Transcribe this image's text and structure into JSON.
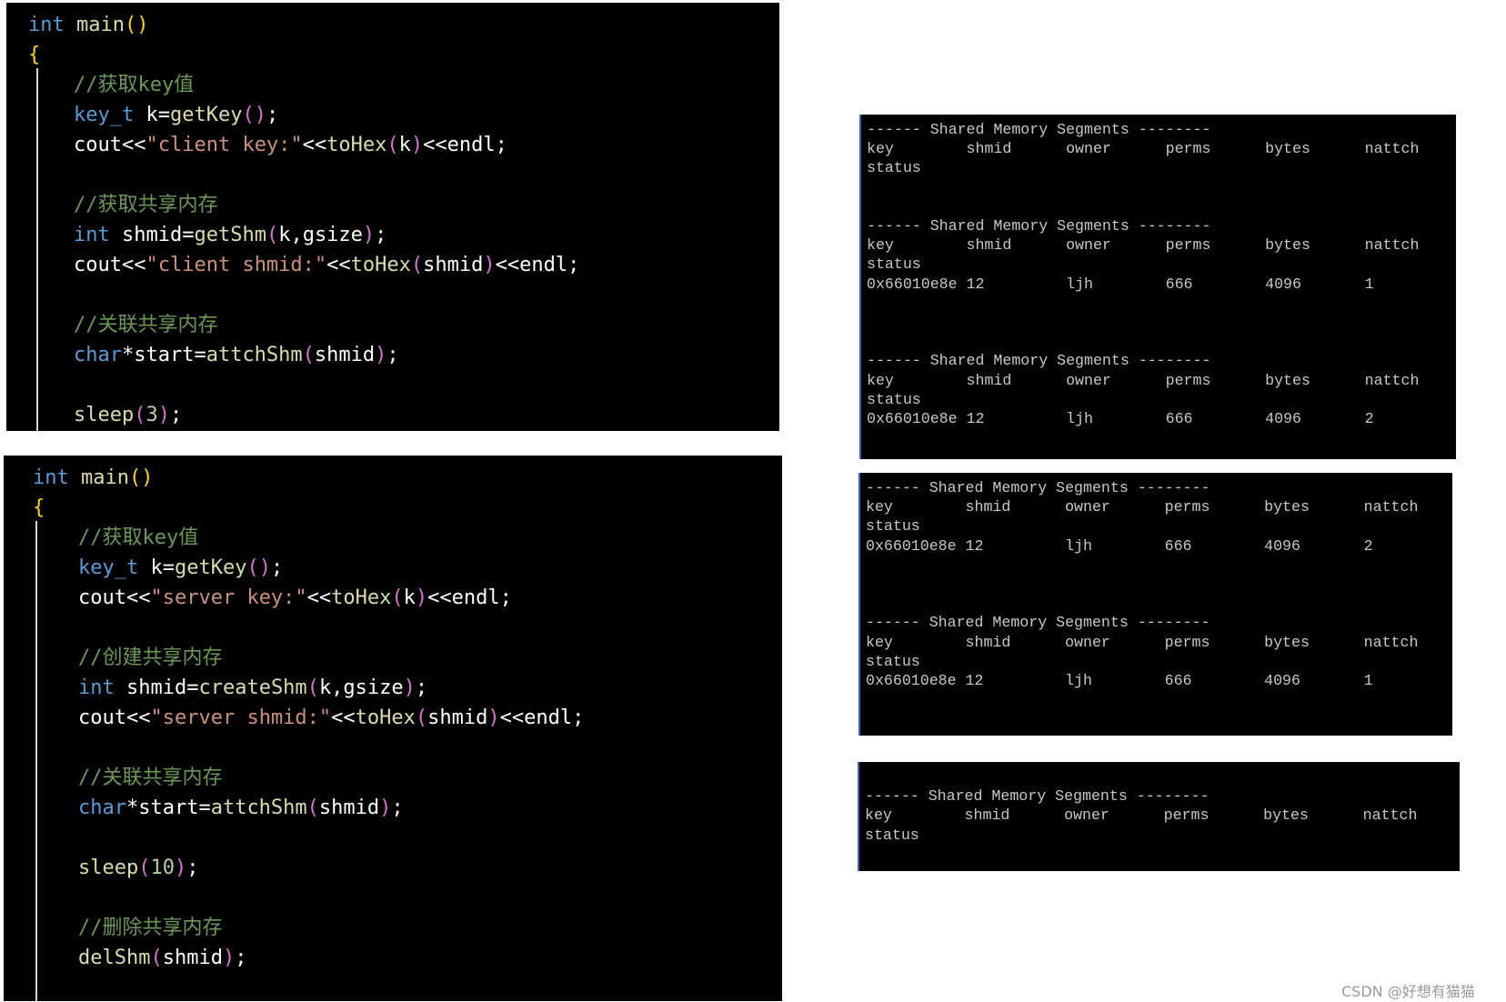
{
  "client_code": {
    "lines": [
      {
        "indent": 0,
        "tokens": [
          [
            "int ",
            "kw"
          ],
          [
            "main",
            "fn"
          ],
          [
            "()",
            "br"
          ]
        ]
      },
      {
        "indent": 0,
        "tokens": [
          [
            "{",
            "br"
          ]
        ]
      },
      {
        "indent": 1,
        "tokens": [
          [
            "//获取key值",
            "cm"
          ]
        ]
      },
      {
        "indent": 1,
        "tokens": [
          [
            "key_t ",
            "kw"
          ],
          [
            "k=",
            "tx"
          ],
          [
            "getKey",
            "fn"
          ],
          [
            "()",
            "pp"
          ],
          [
            ";",
            "tx"
          ]
        ]
      },
      {
        "indent": 1,
        "tokens": [
          [
            "cout<<",
            "tx"
          ],
          [
            "\"client key:\"",
            "str"
          ],
          [
            "<<",
            "tx"
          ],
          [
            "toHex",
            "fn"
          ],
          [
            "(",
            "pp"
          ],
          [
            "k",
            "tx"
          ],
          [
            ")",
            "pp"
          ],
          [
            "<<endl;",
            "tx"
          ]
        ]
      },
      {
        "indent": 1,
        "tokens": []
      },
      {
        "indent": 1,
        "tokens": [
          [
            "//获取共享内存",
            "cm"
          ]
        ]
      },
      {
        "indent": 1,
        "tokens": [
          [
            "int ",
            "kw"
          ],
          [
            "shmid=",
            "tx"
          ],
          [
            "getShm",
            "fn"
          ],
          [
            "(",
            "pp"
          ],
          [
            "k,gsize",
            "tx"
          ],
          [
            ")",
            "pp"
          ],
          [
            ";",
            "tx"
          ]
        ]
      },
      {
        "indent": 1,
        "tokens": [
          [
            "cout<<",
            "tx"
          ],
          [
            "\"client shmid:\"",
            "str"
          ],
          [
            "<<",
            "tx"
          ],
          [
            "toHex",
            "fn"
          ],
          [
            "(",
            "pp"
          ],
          [
            "shmid",
            "tx"
          ],
          [
            ")",
            "pp"
          ],
          [
            "<<endl;",
            "tx"
          ]
        ]
      },
      {
        "indent": 1,
        "tokens": []
      },
      {
        "indent": 1,
        "tokens": [
          [
            "//关联共享内存",
            "cm"
          ]
        ]
      },
      {
        "indent": 1,
        "tokens": [
          [
            "char",
            "kw"
          ],
          [
            "*start=",
            "tx"
          ],
          [
            "attchShm",
            "fn"
          ],
          [
            "(",
            "pp"
          ],
          [
            "shmid",
            "tx"
          ],
          [
            ")",
            "pp"
          ],
          [
            ";",
            "tx"
          ]
        ]
      },
      {
        "indent": 1,
        "tokens": []
      },
      {
        "indent": 1,
        "tokens": [
          [
            "sleep",
            "fn"
          ],
          [
            "(",
            "pp"
          ],
          [
            "3",
            "num"
          ],
          [
            ")",
            "pp"
          ],
          [
            ";",
            "tx"
          ]
        ]
      }
    ]
  },
  "server_code": {
    "lines": [
      {
        "indent": 0,
        "tokens": [
          [
            "int ",
            "kw"
          ],
          [
            "main",
            "fn"
          ],
          [
            "()",
            "br"
          ]
        ]
      },
      {
        "indent": 0,
        "tokens": [
          [
            "{",
            "br"
          ]
        ]
      },
      {
        "indent": 1,
        "tokens": [
          [
            "//获取key值",
            "cm"
          ]
        ]
      },
      {
        "indent": 1,
        "tokens": [
          [
            "key_t ",
            "kw"
          ],
          [
            "k=",
            "tx"
          ],
          [
            "getKey",
            "fn"
          ],
          [
            "()",
            "pp"
          ],
          [
            ";",
            "tx"
          ]
        ]
      },
      {
        "indent": 1,
        "tokens": [
          [
            "cout<<",
            "tx"
          ],
          [
            "\"server key:\"",
            "str"
          ],
          [
            "<<",
            "tx"
          ],
          [
            "toHex",
            "fn"
          ],
          [
            "(",
            "pp"
          ],
          [
            "k",
            "tx"
          ],
          [
            ")",
            "pp"
          ],
          [
            "<<endl;",
            "tx"
          ]
        ]
      },
      {
        "indent": 1,
        "tokens": []
      },
      {
        "indent": 1,
        "tokens": [
          [
            "//创建共享内存",
            "cm"
          ]
        ]
      },
      {
        "indent": 1,
        "tokens": [
          [
            "int ",
            "kw"
          ],
          [
            "shmid=",
            "tx"
          ],
          [
            "createShm",
            "fn"
          ],
          [
            "(",
            "pp"
          ],
          [
            "k,gsize",
            "tx"
          ],
          [
            ")",
            "pp"
          ],
          [
            ";",
            "tx"
          ]
        ]
      },
      {
        "indent": 1,
        "tokens": [
          [
            "cout<<",
            "tx"
          ],
          [
            "\"server shmid:\"",
            "str"
          ],
          [
            "<<",
            "tx"
          ],
          [
            "toHex",
            "fn"
          ],
          [
            "(",
            "pp"
          ],
          [
            "shmid",
            "tx"
          ],
          [
            ")",
            "pp"
          ],
          [
            "<<endl;",
            "tx"
          ]
        ]
      },
      {
        "indent": 1,
        "tokens": []
      },
      {
        "indent": 1,
        "tokens": [
          [
            "//关联共享内存",
            "cm"
          ]
        ]
      },
      {
        "indent": 1,
        "tokens": [
          [
            "char",
            "kw"
          ],
          [
            "*start=",
            "tx"
          ],
          [
            "attchShm",
            "fn"
          ],
          [
            "(",
            "pp"
          ],
          [
            "shmid",
            "tx"
          ],
          [
            ")",
            "pp"
          ],
          [
            ";",
            "tx"
          ]
        ]
      },
      {
        "indent": 1,
        "tokens": []
      },
      {
        "indent": 1,
        "tokens": [
          [
            "sleep",
            "fn"
          ],
          [
            "(",
            "pp"
          ],
          [
            "10",
            "num"
          ],
          [
            ")",
            "pp"
          ],
          [
            ";",
            "tx"
          ]
        ]
      },
      {
        "indent": 1,
        "tokens": []
      },
      {
        "indent": 1,
        "tokens": [
          [
            "//删除共享内存",
            "cm"
          ]
        ]
      },
      {
        "indent": 1,
        "tokens": [
          [
            "delShm",
            "fn"
          ],
          [
            "(",
            "pp"
          ],
          [
            "shmid",
            "tx"
          ],
          [
            ")",
            "pp"
          ],
          [
            ";",
            "tx"
          ]
        ]
      }
    ]
  },
  "terminals": [
    {
      "lines": [
        "------ Shared Memory Segments --------",
        "key        shmid      owner      perms      bytes      nattch",
        "status",
        "",
        "",
        "------ Shared Memory Segments --------",
        "key        shmid      owner      perms      bytes      nattch",
        "status",
        "0x66010e8e 12         ljh        666        4096       1",
        "",
        "",
        "",
        "------ Shared Memory Segments --------",
        "key        shmid      owner      perms      bytes      nattch",
        "status",
        "0x66010e8e 12         ljh        666        4096       2"
      ]
    },
    {
      "lines": [
        "------ Shared Memory Segments --------",
        "key        shmid      owner      perms      bytes      nattch",
        "status",
        "0x66010e8e 12         ljh        666        4096       2",
        "",
        "",
        "",
        "------ Shared Memory Segments --------",
        "key        shmid      owner      perms      bytes      nattch",
        "status",
        "0x66010e8e 12         ljh        666        4096       1"
      ]
    },
    {
      "lines": [
        "",
        "------ Shared Memory Segments --------",
        "key        shmid      owner      perms      bytes      nattch",
        "status"
      ]
    }
  ],
  "watermark": "CSDN @好想有猫猫"
}
